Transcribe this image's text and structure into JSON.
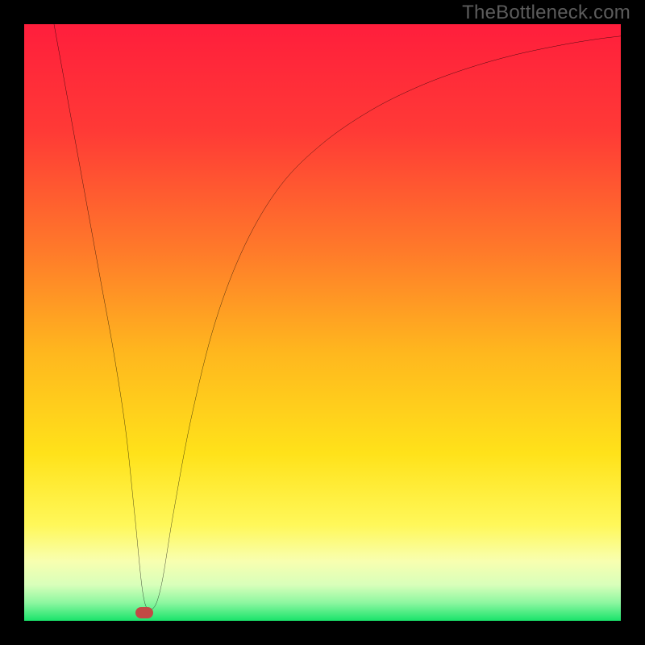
{
  "watermark": "TheBottleneck.com",
  "chart_data": {
    "type": "line",
    "title": "",
    "xlabel": "",
    "ylabel": "",
    "xlim": [
      0,
      100
    ],
    "ylim": [
      0,
      100
    ],
    "gradient_stops": [
      {
        "offset": 0,
        "color": "#ff1e3c"
      },
      {
        "offset": 0.18,
        "color": "#ff3a36"
      },
      {
        "offset": 0.38,
        "color": "#ff7a2a"
      },
      {
        "offset": 0.55,
        "color": "#ffb71e"
      },
      {
        "offset": 0.72,
        "color": "#ffe21a"
      },
      {
        "offset": 0.84,
        "color": "#fff85a"
      },
      {
        "offset": 0.9,
        "color": "#f8ffb0"
      },
      {
        "offset": 0.94,
        "color": "#d8ffba"
      },
      {
        "offset": 0.97,
        "color": "#8cf7a0"
      },
      {
        "offset": 1.0,
        "color": "#19e36a"
      }
    ],
    "series": [
      {
        "name": "bottleneck-curve",
        "x": [
          5,
          7,
          9,
          11,
          13,
          15,
          17,
          18.5,
          20,
          21.5,
          23,
          25,
          28,
          32,
          37,
          43,
          50,
          58,
          66,
          74,
          82,
          90,
          96,
          100
        ],
        "y": [
          100,
          89,
          78,
          67,
          56,
          45,
          32,
          18,
          4,
          2,
          6,
          18,
          34,
          50,
          63,
          73,
          80,
          85.5,
          89.5,
          92.5,
          94.8,
          96.5,
          97.5,
          98
        ]
      }
    ],
    "marker": {
      "x": 20.2,
      "y": 1.4,
      "color": "#c24a45"
    }
  }
}
